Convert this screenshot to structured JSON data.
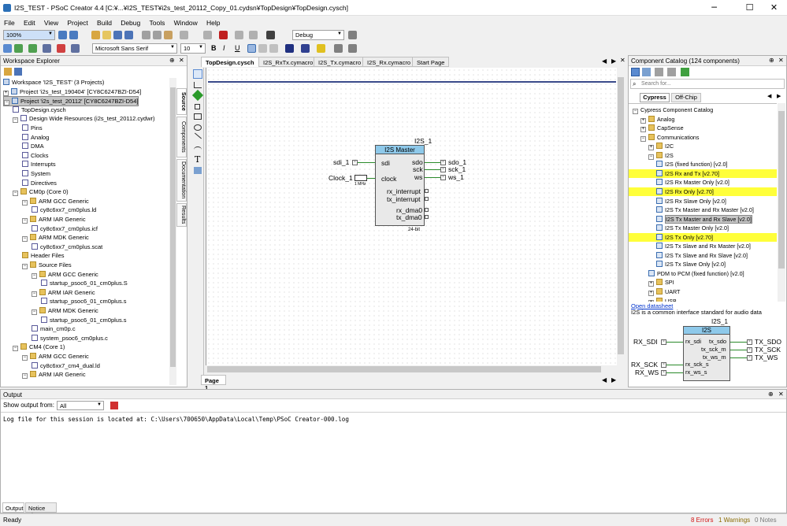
{
  "window": {
    "title": "I2S_TEST - PSoC Creator 4.4 [C:¥...¥I2S_TEST¥i2s_test_20112_Copy_01.cydsn¥TopDesign¥TopDesign.cysch]",
    "minimize": "─",
    "maximize": "☐",
    "close": "✕"
  },
  "menu": [
    "File",
    "Edit",
    "View",
    "Project",
    "Build",
    "Debug",
    "Tools",
    "Window",
    "Help"
  ],
  "toolbar": {
    "zoom_value": "100%",
    "config_value": "Debug",
    "font_value": "Microsoft Sans Serif",
    "font_size": "10",
    "bold": "B",
    "italic": "I",
    "underline": "U"
  },
  "workspace": {
    "title": "Workspace Explorer",
    "items": [
      {
        "text": "Workspace 'I2S_TEST' (3 Projects)",
        "level": 0,
        "icon": "prj",
        "exp": ""
      },
      {
        "text": "Project 'i2s_test_190404' [CY8C6247BZI-D54]",
        "level": 0,
        "icon": "prj",
        "exp": "+"
      },
      {
        "text": "Project 'i2s_test_20112' [CY8C6247BZI-D54]",
        "level": 0,
        "icon": "prj",
        "exp": "−",
        "selected": true
      },
      {
        "text": "TopDesign.cysch",
        "level": 1,
        "icon": "file",
        "exp": ""
      },
      {
        "text": "Design Wide Resources (i2s_test_20112.cydwr)",
        "level": 1,
        "icon": "file",
        "exp": "−"
      },
      {
        "text": "Pins",
        "level": 2,
        "icon": "file",
        "exp": ""
      },
      {
        "text": "Analog",
        "level": 2,
        "icon": "file",
        "exp": ""
      },
      {
        "text": "DMA",
        "level": 2,
        "icon": "file",
        "exp": ""
      },
      {
        "text": "Clocks",
        "level": 2,
        "icon": "file",
        "exp": ""
      },
      {
        "text": "Interrupts",
        "level": 2,
        "icon": "file",
        "exp": ""
      },
      {
        "text": "System",
        "level": 2,
        "icon": "file",
        "exp": ""
      },
      {
        "text": "Directives",
        "level": 2,
        "icon": "file",
        "exp": ""
      },
      {
        "text": "CM0p (Core 0)",
        "level": 1,
        "icon": "fold",
        "exp": "−"
      },
      {
        "text": "ARM GCC Generic",
        "level": 2,
        "icon": "fold",
        "exp": "−"
      },
      {
        "text": "cy8c6xx7_cm0plus.ld",
        "level": 3,
        "icon": "file",
        "exp": ""
      },
      {
        "text": "ARM IAR Generic",
        "level": 2,
        "icon": "fold",
        "exp": "−"
      },
      {
        "text": "cy8c6xx7_cm0plus.icf",
        "level": 3,
        "icon": "file",
        "exp": ""
      },
      {
        "text": "ARM MDK Generic",
        "level": 2,
        "icon": "fold",
        "exp": "−"
      },
      {
        "text": "cy8c6xx7_cm0plus.scat",
        "level": 3,
        "icon": "file",
        "exp": ""
      },
      {
        "text": "Header Files",
        "level": 2,
        "icon": "fold",
        "exp": ""
      },
      {
        "text": "Source Files",
        "level": 2,
        "icon": "fold",
        "exp": "−"
      },
      {
        "text": "ARM GCC Generic",
        "level": 3,
        "icon": "fold",
        "exp": "−"
      },
      {
        "text": "startup_psoc6_01_cm0plus.S",
        "level": 4,
        "icon": "file",
        "exp": ""
      },
      {
        "text": "ARM IAR Generic",
        "level": 3,
        "icon": "fold",
        "exp": "−"
      },
      {
        "text": "startup_psoc6_01_cm0plus.s",
        "level": 4,
        "icon": "file",
        "exp": ""
      },
      {
        "text": "ARM MDK Generic",
        "level": 3,
        "icon": "fold",
        "exp": "−"
      },
      {
        "text": "startup_psoc6_01_cm0plus.s",
        "level": 4,
        "icon": "file",
        "exp": ""
      },
      {
        "text": "main_cm0p.c",
        "level": 3,
        "icon": "file",
        "exp": ""
      },
      {
        "text": "system_psoc6_cm0plus.c",
        "level": 3,
        "icon": "file",
        "exp": ""
      },
      {
        "text": "CM4 (Core 1)",
        "level": 1,
        "icon": "fold",
        "exp": "−"
      },
      {
        "text": "ARM GCC Generic",
        "level": 2,
        "icon": "fold",
        "exp": "−"
      },
      {
        "text": "cy8c6xx7_cm4_dual.ld",
        "level": 3,
        "icon": "file",
        "exp": ""
      },
      {
        "text": "ARM IAR Generic",
        "level": 2,
        "icon": "fold",
        "exp": "−"
      }
    ],
    "side_tabs": [
      "Source",
      "Components",
      "Documentation",
      "Results"
    ]
  },
  "doc_tabs": [
    "TopDesign.cysch",
    "I2S_RxTx.cymacro",
    "I2S_Tx.cymacro",
    "I2S_Rx.cymacro",
    "Start Page"
  ],
  "schematic": {
    "page_tab": "Page 1",
    "instance": "I2S_1",
    "block_title": "I2S Master",
    "left_ports": [
      "sdi",
      "clock"
    ],
    "right_ports": [
      "sdo",
      "sck",
      "ws",
      "rx_interrupt",
      "tx_interrupt",
      "rx_dma0",
      "tx_dma0"
    ],
    "footer": "24-bit",
    "pins_left": [
      "sdi_1",
      "Clock_1"
    ],
    "clock_freq": "1 MHz",
    "pins_right": [
      "sdo_1",
      "sck_1",
      "ws_1"
    ]
  },
  "catalog": {
    "title": "Component Catalog (124 components)",
    "search_placeholder": "Search for...",
    "tabs": [
      "Cypress",
      "Off-Chip"
    ],
    "items": [
      {
        "text": "Cypress Component Catalog",
        "level": 0,
        "exp": "−",
        "hl": false
      },
      {
        "text": "Analog",
        "level": 1,
        "exp": "+",
        "hl": false
      },
      {
        "text": "CapSense",
        "level": 1,
        "exp": "+",
        "hl": false
      },
      {
        "text": "Communications",
        "level": 1,
        "exp": "−",
        "hl": false
      },
      {
        "text": "I2C",
        "level": 2,
        "exp": "+",
        "hl": false
      },
      {
        "text": "I2S",
        "level": 2,
        "exp": "−",
        "hl": false
      },
      {
        "text": "I2S (fixed function) [v2.0]",
        "level": 3,
        "exp": "",
        "hl": false
      },
      {
        "text": "I2S Rx and Tx [v2.70]",
        "level": 3,
        "exp": "",
        "hl": true
      },
      {
        "text": "I2S Rx Master Only [v2.0]",
        "level": 3,
        "exp": "",
        "hl": false
      },
      {
        "text": "I2S Rx Only [v2.70]",
        "level": 3,
        "exp": "",
        "hl": true
      },
      {
        "text": "I2S Rx Slave Only [v2.0]",
        "level": 3,
        "exp": "",
        "hl": false
      },
      {
        "text": "I2S Tx Master and Rx Master [v2.0]",
        "level": 3,
        "exp": "",
        "hl": false
      },
      {
        "text": "I2S Tx Master and Rx Slave [v2.0]",
        "level": 3,
        "exp": "",
        "hl": false,
        "sel": true
      },
      {
        "text": "I2S Tx Master Only [v2.0]",
        "level": 3,
        "exp": "",
        "hl": false
      },
      {
        "text": "I2S Tx Only [v2.70]",
        "level": 3,
        "exp": "",
        "hl": true
      },
      {
        "text": "I2S Tx Slave and Rx Master [v2.0]",
        "level": 3,
        "exp": "",
        "hl": false
      },
      {
        "text": "I2S Tx Slave and Rx Slave [v2.0]",
        "level": 3,
        "exp": "",
        "hl": false
      },
      {
        "text": "I2S Tx Slave Only [v2.0]",
        "level": 3,
        "exp": "",
        "hl": false
      },
      {
        "text": "PDM to PCM (fixed function) [v2.0]",
        "level": 2,
        "exp": "",
        "hl": false
      },
      {
        "text": "SPI",
        "level": 2,
        "exp": "+",
        "hl": false
      },
      {
        "text": "UART",
        "level": 2,
        "exp": "+",
        "hl": false
      },
      {
        "text": "USB",
        "level": 2,
        "exp": "+",
        "hl": false
      }
    ],
    "datasheet_link": "Open datasheet",
    "description": "I2S is a common interface standard for audio data",
    "preview": {
      "instance": "I2S_1",
      "title": "I2S",
      "left_pins": [
        "RX_SDI",
        "RX_SCK",
        "RX_WS"
      ],
      "inner_left": [
        "rx_sdi",
        "rx_sck_s",
        "rx_ws_s"
      ],
      "inner_right": [
        "tx_sdo",
        "tx_sck_m",
        "tx_ws_m"
      ],
      "right_pins": [
        "TX_SDO",
        "TX_SCK",
        "TX_WS"
      ]
    }
  },
  "output": {
    "title": "Output",
    "show_from_label": "Show output from:",
    "show_from_value": "All",
    "log": "Log file for this session is located at: C:\\Users\\700650\\AppData\\Local\\Temp\\PSoC Creator-000.log",
    "tabs": [
      "Output",
      "Notice List"
    ]
  },
  "status": {
    "ready": "Ready",
    "errors": "8 Errors",
    "warnings": "1 Warnings",
    "notes": "0 Notes",
    "error_color": "#d21414"
  }
}
